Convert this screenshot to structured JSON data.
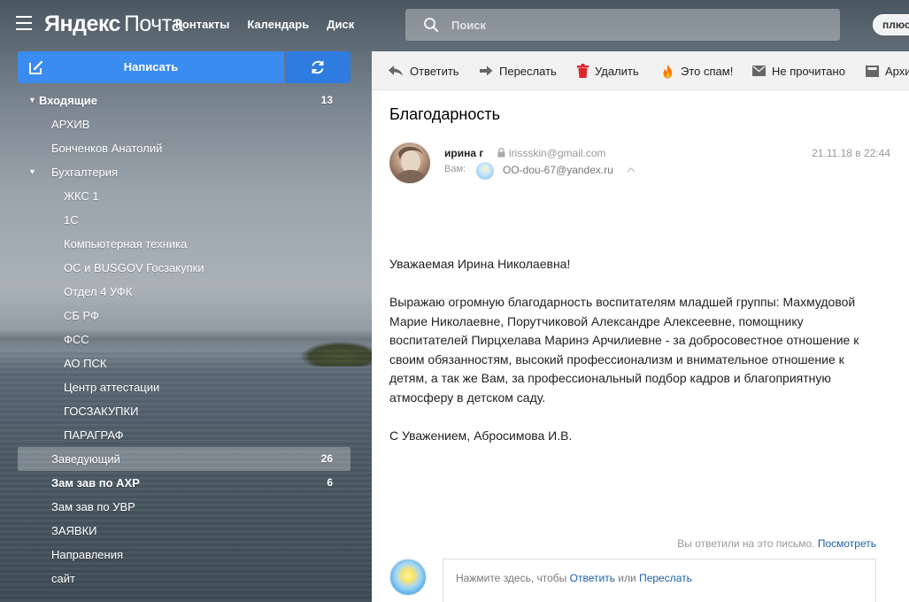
{
  "header": {
    "logo_brand": "Яндекс",
    "logo_service": "Почта",
    "nav": [
      "Контакты",
      "Календарь",
      "Диск"
    ],
    "search_placeholder": "Поиск",
    "plus_label": "плюс"
  },
  "compose": {
    "label": "Написать"
  },
  "folders": [
    {
      "name": "Входящие",
      "count": "13",
      "bold": true,
      "level": "inbox",
      "expanded": true
    },
    {
      "name": "АРХИВ",
      "count": "",
      "level": "l0"
    },
    {
      "name": "Бонченков Анатолий",
      "count": "",
      "level": "l0"
    },
    {
      "name": "Бухгалтерия",
      "count": "",
      "level": "l0",
      "expanded": true
    },
    {
      "name": "ЖКС 1",
      "count": "",
      "level": "l1"
    },
    {
      "name": "1С",
      "count": "",
      "level": "l1"
    },
    {
      "name": "Компьютерная техника",
      "count": "",
      "level": "l1"
    },
    {
      "name": "ОС и BUSGOV Госзакупки",
      "count": "",
      "level": "l1"
    },
    {
      "name": "Отдел 4 УФК",
      "count": "",
      "level": "l1"
    },
    {
      "name": "СБ РФ",
      "count": "",
      "level": "l1"
    },
    {
      "name": "ФСС",
      "count": "",
      "level": "l1"
    },
    {
      "name": "АО ПСК",
      "count": "",
      "level": "l1"
    },
    {
      "name": "Центр аттестации",
      "count": "",
      "level": "l1"
    },
    {
      "name": "ГОСЗАКУПКИ",
      "count": "",
      "level": "l1"
    },
    {
      "name": "ПАРАГРАФ",
      "count": "",
      "level": "l1"
    },
    {
      "name": "Заведующий",
      "count": "26",
      "level": "l0",
      "active": true
    },
    {
      "name": "Зам зав по АХР",
      "count": "6",
      "level": "l0",
      "bold": true
    },
    {
      "name": "Зам зав по УВР",
      "count": "",
      "level": "l0"
    },
    {
      "name": "ЗАЯВКИ",
      "count": "",
      "level": "l0"
    },
    {
      "name": "Направления",
      "count": "",
      "level": "l0"
    },
    {
      "name": "сайт",
      "count": "",
      "level": "l0"
    }
  ],
  "toolbar": {
    "reply": "Ответить",
    "forward": "Переслать",
    "delete": "Удалить",
    "spam": "Это спам!",
    "unread": "Не прочитано",
    "archive": "Архив"
  },
  "message": {
    "subject": "Благодарность",
    "sender_name": "ирина г",
    "sender_email": "irissskin@gmail.com",
    "date": "21.11.18 в 22:44",
    "to_label": "Вам:",
    "to_email": "OO-dou-67@yandex.ru",
    "greeting": "Уважаемая Ирина Николаевна!",
    "paragraph": "Выражаю огромную благодарность воспитателям младшей группы: Махмудовой Марие Николаевне, Порутчиковой Александре Алексеевне, помощнику воспитателей Пирцхелава Маринэ Арчилиевне -  за добросовестное отношение к своим обязанностям, высокий профессионализм и внимательное отношение к детям, а так же Вам, за профессиональный подбор кадров и благоприятную атмосферу в детском саду.",
    "signature": "С Уважением, Абросимова И.В."
  },
  "replied": {
    "text": "Вы ответили на это письмо.",
    "link": "Посмотреть"
  },
  "quick_reply": {
    "prefix": "Нажмите здесь, чтобы",
    "reply_link": "Ответить",
    "or": "или",
    "forward_link": "Переслать"
  },
  "colors": {
    "compose": "#3a8cf0",
    "refresh": "#2f7ce0",
    "link": "#1a5fa8",
    "delete_icon": "#e0262b",
    "spam_icon": "#ff7a00"
  }
}
